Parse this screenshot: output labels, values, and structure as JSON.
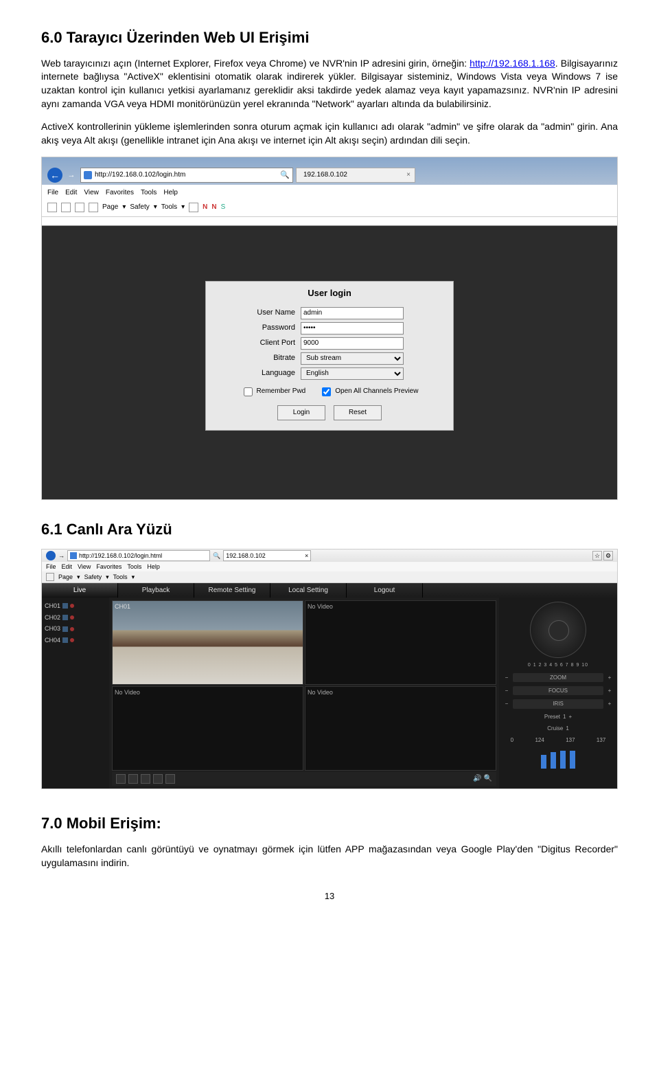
{
  "sec60": {
    "heading": "6.0 Tarayıcı Üzerinden Web UI Erişimi",
    "para1_a": "Web tarayıcınızı açın (Internet Explorer, Firefox veya Chrome) ve NVR'nin IP adresini girin, örneğin: ",
    "url": "http://192.168.1.168",
    "para1_b": ". Bilgisayarınız internete bağlıysa \"ActiveX\" eklentisini otomatik olarak indirerek yükler. Bilgisayar sisteminiz, Windows Vista veya Windows 7 ise uzaktan kontrol için kullanıcı yetkisi ayarlamanız gereklidir aksi takdirde yedek alamaz veya kayıt yapamazsınız. NVR'nin IP adresini aynı zamanda VGA veya HDMI monitörünüzün yerel ekranında \"Network\" ayarları altında da bulabilirsiniz.",
    "para2": "ActiveX kontrollerinin yükleme işlemlerinden sonra oturum açmak için kullanıcı adı olarak \"admin\" ve şifre olarak da \"admin\" girin. Ana akış veya Alt akışı (genellikle intranet için Ana akışı ve internet için Alt akışı seçin) ardından dili seçin."
  },
  "browser": {
    "address": "http://192.168.0.102/login.htm",
    "tab_title": "192.168.0.102",
    "menus": [
      "File",
      "Edit",
      "View",
      "Favorites",
      "Tools",
      "Help"
    ],
    "tb_labels": [
      "Page",
      "Safety",
      "Tools"
    ]
  },
  "login": {
    "title": "User login",
    "user_label": "User Name",
    "user_val": "admin",
    "pwd_label": "Password",
    "pwd_val": "•••••",
    "port_label": "Client Port",
    "port_val": "9000",
    "bitrate_label": "Bitrate",
    "bitrate_val": "Sub stream",
    "lang_label": "Language",
    "lang_val": "English",
    "remember": "Remember Pwd",
    "openall": "Open All Channels Preview",
    "login_btn": "Login",
    "reset_btn": "Reset"
  },
  "sec61": {
    "heading": "6.1 Canlı Ara Yüzü"
  },
  "live": {
    "address": "http://192.168.0.102/login.html",
    "tab_title": "192.168.0.102",
    "tabs": [
      "Live",
      "Playback",
      "Remote Setting",
      "Local Setting",
      "Logout"
    ],
    "channels": [
      "CH01",
      "CH02",
      "CH03",
      "CH04"
    ],
    "grid": {
      "ch01": "CH01",
      "nv": "No Video"
    },
    "nums": "0 1 2 3 4 5 6 7 8 9 10",
    "sliders": [
      "ZOOM",
      "FOCUS",
      "IRIS"
    ],
    "preset": "Preset",
    "cruise": "Cruise",
    "counts": [
      "0",
      "124",
      "137",
      "137"
    ]
  },
  "sec70": {
    "heading": "7.0   Mobil Erişim:",
    "para": "Akıllı telefonlardan canlı görüntüyü ve oynatmayı görmek için lütfen APP mağazasından veya Google Play'den \"Digitus Recorder\" uygulamasını indirin."
  },
  "page_number": "13"
}
